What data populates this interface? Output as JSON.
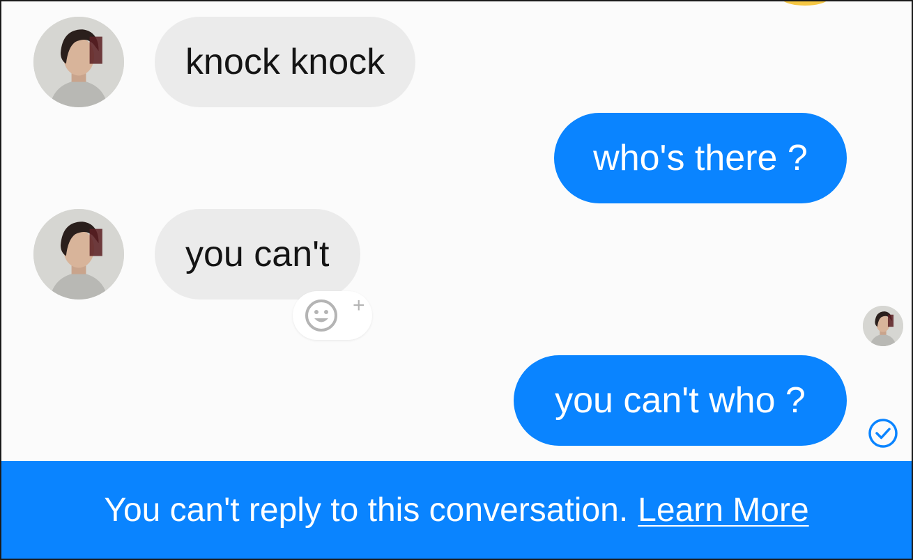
{
  "messages": [
    {
      "direction": "incoming",
      "text": "knock knock"
    },
    {
      "direction": "outgoing",
      "text": "who's there ?"
    },
    {
      "direction": "incoming",
      "text": "you can't"
    },
    {
      "direction": "outgoing",
      "text": "you can't who ?"
    }
  ],
  "reaction_button": {
    "icon": "smiley-add-icon",
    "plus": "+"
  },
  "status": {
    "seen_icon": "seen-avatar",
    "sent_icon": "check-circle-icon"
  },
  "notice": {
    "text": "You can't reply to this conversation.",
    "link_label": "Learn More"
  },
  "colors": {
    "accent": "#0a84ff",
    "incoming_bubble": "#ebebeb",
    "background": "#fbfbfb"
  }
}
